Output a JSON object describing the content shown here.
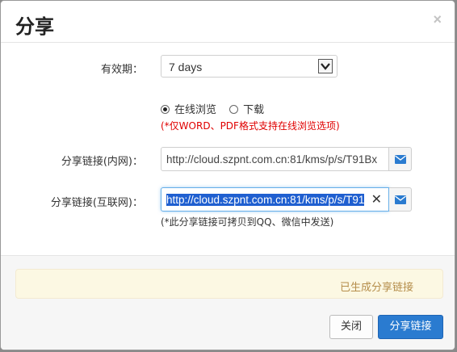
{
  "dialog": {
    "title": "分享",
    "close_glyph": "×"
  },
  "validity": {
    "label": "有效期：",
    "selected": "7 days"
  },
  "mode": {
    "options": [
      {
        "label": "在线浏览",
        "checked": true
      },
      {
        "label": "下载",
        "checked": false
      }
    ],
    "note": "(*仅WORD、PDF格式支持在线浏览选项)"
  },
  "intranet": {
    "label": "分享链接(内网)：",
    "value": "http://cloud.szpnt.com.cn:81/kms/p/s/T91Bx"
  },
  "internet": {
    "label": "分享链接(互联网)：",
    "value": "http://cloud.szpnt.com.cn:81/kms/p/s/T91",
    "clear_glyph": "✕",
    "note": "(*此分享链接可拷贝到QQ、微信中发送)"
  },
  "alert": {
    "message": "已生成分享链接"
  },
  "footer": {
    "close_label": "关闭",
    "share_label": "分享链接"
  },
  "colors": {
    "primary": "#2a7bd0",
    "warning_text": "#b58d4a",
    "note_red": "#e00000"
  },
  "icons": [
    "close-icon",
    "chevron-down-icon",
    "envelope-icon",
    "clear-icon"
  ]
}
